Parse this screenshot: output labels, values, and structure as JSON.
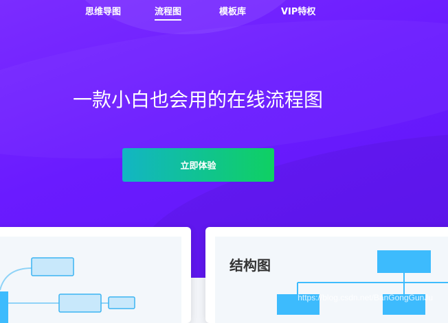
{
  "nav": {
    "items": [
      {
        "label": "思维导图"
      },
      {
        "label": "流程图",
        "active": true
      },
      {
        "label": "模板库"
      },
      {
        "label": "VIP特权"
      }
    ]
  },
  "hero": {
    "headline": "一款小白也会用的在线流程图",
    "cta_label": "立即体验"
  },
  "cards": {
    "right_title": "结构图"
  },
  "watermark": "https://blog.csdn.net/BanGongGunJu",
  "colors": {
    "hero_gradient_start": "#7b2cff",
    "hero_gradient_end": "#5f16f5",
    "cta_gradient_start": "#12b5c4",
    "cta_gradient_end": "#0fd062",
    "diagram_node_fill": "#c8e8fb",
    "diagram_node_stroke": "#3bb4f2",
    "structure_node_fill": "#3dbbfd"
  }
}
